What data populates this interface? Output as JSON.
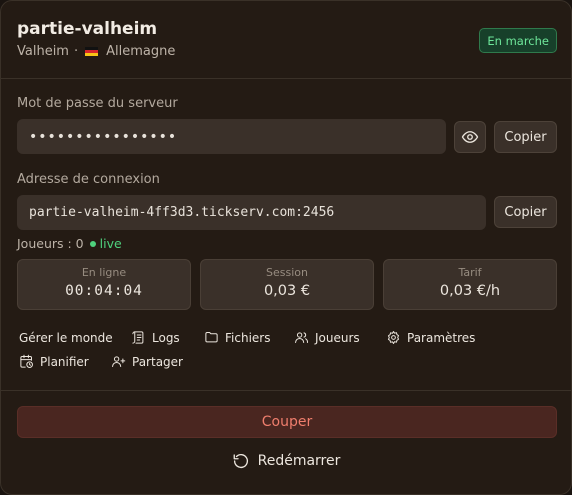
{
  "server": {
    "name": "partie-valheim",
    "game": "Valheim",
    "separator": "·",
    "region": "Allemagne",
    "status": "En marche"
  },
  "password": {
    "label": "Mot de passe du serveur",
    "masked_value": "••••••••••••••••",
    "copy_label": "Copier"
  },
  "connection": {
    "label": "Adresse de connexion",
    "address": "partie-valheim-4ff3d3.tickserv.com:2456",
    "copy_label": "Copier"
  },
  "players": {
    "label": "Joueurs : 0",
    "live_label": "live"
  },
  "stats": [
    {
      "label": "En ligne",
      "value": "00:04:04"
    },
    {
      "label": "Session",
      "value": "0,03 €"
    },
    {
      "label": "Tarif",
      "value": "0,03 €/h"
    }
  ],
  "actions": {
    "manage": "Gérer le monde",
    "logs": "Logs",
    "files": "Fichiers",
    "players": "Joueurs",
    "settings": "Paramètres",
    "schedule": "Planifier",
    "share": "Partager"
  },
  "stop_label": "Couper",
  "restart_label": "Redémarrer",
  "colors": {
    "background": "#241b14",
    "status_green": "#6ee69a",
    "stop_red": "#ef7e6d"
  }
}
